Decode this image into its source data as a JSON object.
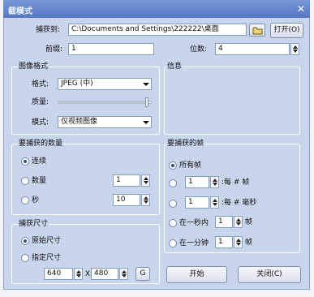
{
  "window": {
    "title": "截模式",
    "close_glyph": "✕"
  },
  "capture_to": {
    "label": "捕获到:",
    "path": "C:\\Documents and Settings\\222222\\桌面",
    "open_button": "打开(O)"
  },
  "prefix": {
    "label": "前缀:",
    "value": "1"
  },
  "digits": {
    "label": "位数:",
    "value": "4"
  },
  "image_format": {
    "title": "图像格式",
    "format_label": "格式:",
    "format_value": "JPEG (中)",
    "quality_label": "质量:",
    "quality_level": 0.97,
    "mode_label": "模式:",
    "mode_value": "仅视频图像"
  },
  "info": {
    "title": "信息"
  },
  "capture_count": {
    "title": "要捕获的数量",
    "continuous_label": "连续",
    "count_label": "数量",
    "count_value": "1",
    "seconds_label": "秒",
    "seconds_value": "10",
    "selected": "continuous"
  },
  "capture_frames": {
    "title": "要捕获的帧",
    "all_frames_label": "所有帧",
    "every_frame_value": "1",
    "every_frame_suffix": ":每 # 帧",
    "every_ms_value": "1",
    "every_ms_suffix": ":每 # 毫秒",
    "per_second_label": "在一秒内",
    "per_second_value": "1",
    "per_second_suffix": "帧",
    "per_minute_label": "在一分钟",
    "per_minute_value": "1",
    "per_minute_suffix": "帧",
    "selected": "all"
  },
  "capture_size": {
    "title": "捕获尺寸",
    "original_label": "原始尺寸",
    "custom_label": "指定尺寸",
    "width_value": "640",
    "x_label": "X",
    "height_value": "480",
    "g_button": "G",
    "selected": "original"
  },
  "actions": {
    "start_button": "开始",
    "close_button": "关闭(C)"
  }
}
